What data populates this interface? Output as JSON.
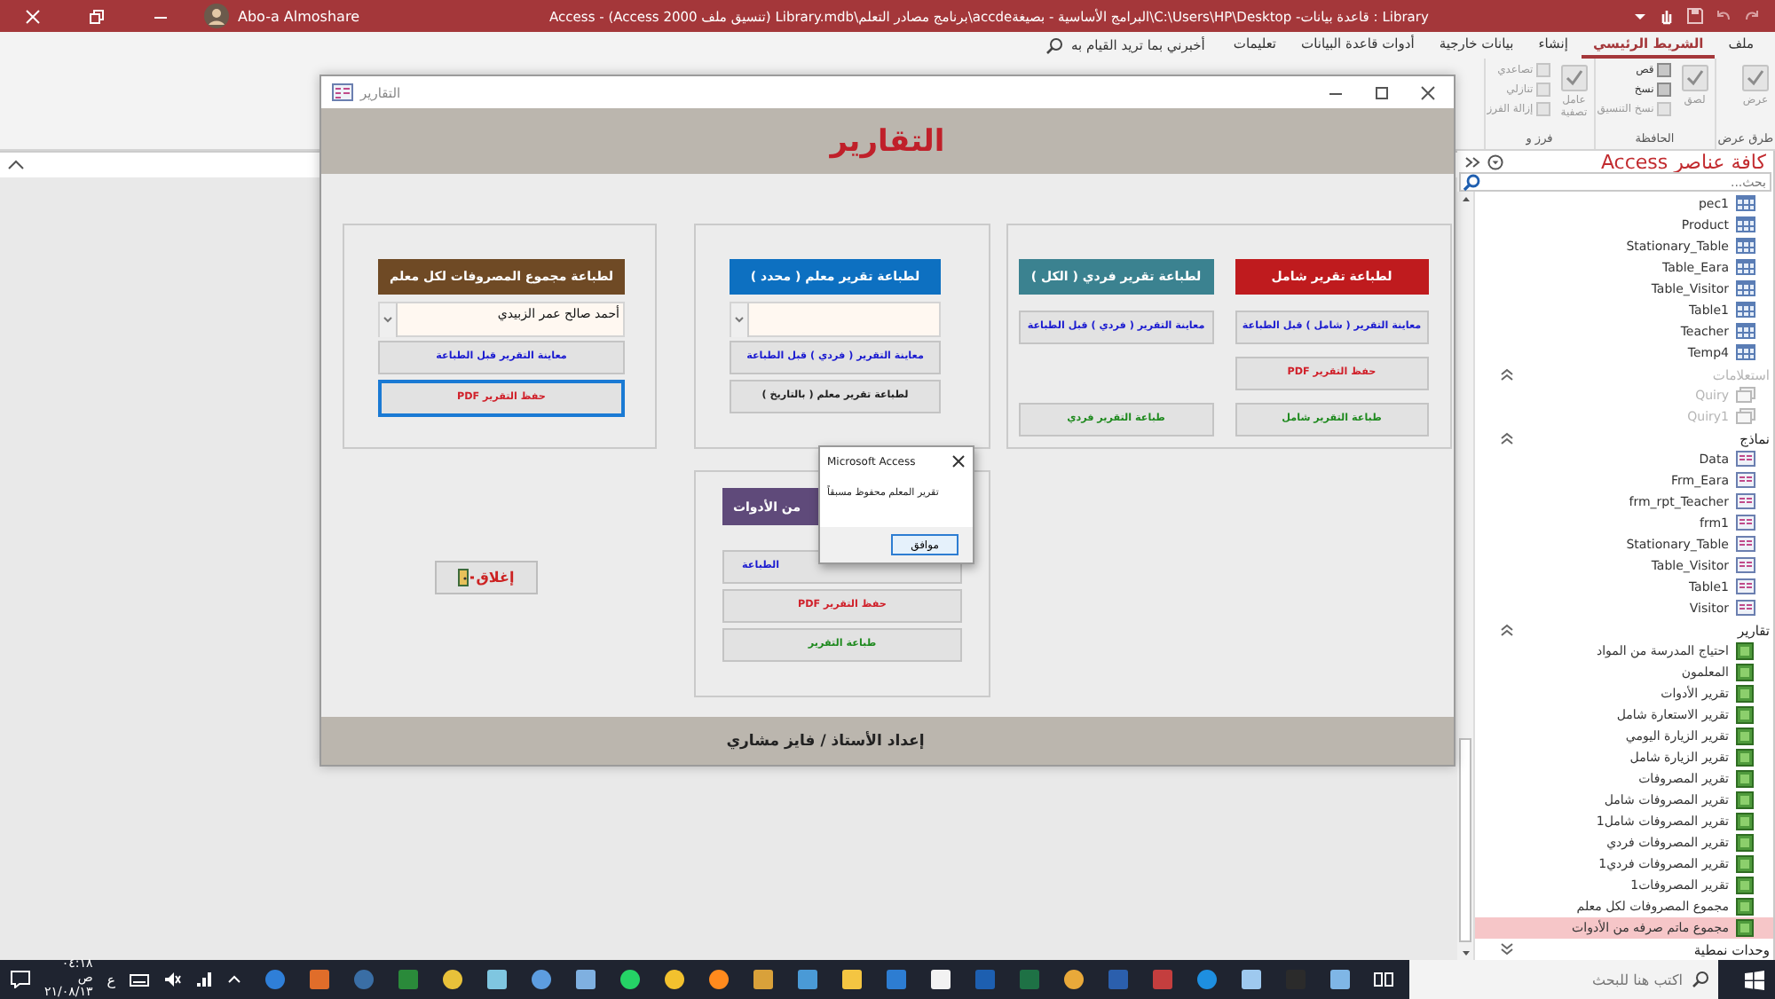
{
  "title_bar": {
    "title": "Library : قاعدة بيانات- C:\\Users\\HP\\Desktop\\البرامج الأساسية - بصيغةaccde\\برنامج مصادر التعلم\\Library.mdb (تنسيق ملف Access 2000) - Access",
    "user": "Abo-a Almoshare"
  },
  "ribbon": {
    "tabs": [
      {
        "label": "ملف",
        "selected": false
      },
      {
        "label": "الشريط الرئيسي",
        "selected": true
      },
      {
        "label": "إنشاء",
        "selected": false
      },
      {
        "label": "بيانات خارجية",
        "selected": false
      },
      {
        "label": "أدوات قاعدة البيانات",
        "selected": false
      },
      {
        "label": "تعليمات",
        "selected": false
      }
    ],
    "tell_me": "أخبرني بما تريد القيام به",
    "groups": [
      {
        "label": "طرق عرض",
        "commands": [
          {
            "label": "عرض",
            "kind": "large",
            "disabled": true
          }
        ]
      },
      {
        "label": "الحافظة",
        "commands": [
          {
            "label": "لصق",
            "kind": "large",
            "disabled": true
          },
          {
            "label": "قص",
            "kind": "small",
            "disabled": false
          },
          {
            "label": "نسخ",
            "kind": "small",
            "disabled": false
          },
          {
            "label": "نسخ التنسيق",
            "kind": "small",
            "disabled": true
          }
        ]
      },
      {
        "label": "فرز و",
        "commands": [
          {
            "label": "عامل تصفية",
            "kind": "large",
            "disabled": true
          },
          {
            "label": "تصاعدي",
            "kind": "small",
            "disabled": true
          },
          {
            "label": "تنازلي",
            "kind": "small",
            "disabled": true
          },
          {
            "label": "إزالة الفرز",
            "kind": "small",
            "disabled": true
          }
        ]
      }
    ]
  },
  "form_window": {
    "title": "التقارير",
    "heading": "التقارير",
    "panels": [
      {
        "sections": [
          {
            "header": "لطباعة تقرير شامل",
            "color": "#bf1b1e",
            "buttons": [
              {
                "label": "معاينة التقرير ( شامل ) قبل الطباعة",
                "kind": "preview",
                "focused": false
              },
              {
                "label": "حفظ التقرير PDF",
                "kind": "pdf",
                "focused": false
              },
              {
                "label": "طباعة التقرير شامل",
                "kind": "print",
                "focused": false
              }
            ]
          },
          {
            "header": "لطباعة تقرير فردي ( الكل )",
            "color": "#3b8290",
            "buttons": [
              {
                "label": "معاينة التقرير ( فردي ) قبل الطباعة",
                "kind": "preview",
                "focused": false
              },
              {
                "label": "طباعة التقرير فردي",
                "kind": "print",
                "focused": false
              }
            ]
          }
        ]
      },
      {
        "sections": [
          {
            "header": "لطباعة تقرير معلم ( محدد )",
            "color": "#0d70c1",
            "combo": {
              "kind": "dropdown"
            },
            "buttons": [
              {
                "label": "معاينة التقرير ( فردي ) قبل الطباعة",
                "kind": "preview",
                "focused": false
              },
              {
                "label": "لطباعة تقرير معلم ( بالتاريخ )",
                "kind": "date",
                "focused": false
              }
            ]
          }
        ]
      },
      {
        "sections": [
          {
            "header": "لطباعة مجموع المصروفات لكل معلم",
            "color": "#6f4a25",
            "combo": {
              "kind": "dropdown",
              "value": "أحمد صالح عمر الزبيدي"
            },
            "buttons": [
              {
                "label": "معاينة التقرير قبل الطباعة",
                "kind": "preview",
                "focused": false
              },
              {
                "label": "حفظ التقرير PDF",
                "kind": "pdf",
                "focused": true
              }
            ]
          }
        ]
      },
      {
        "sections": [
          {
            "header": "من الأدوات",
            "color": "#5f4a7a",
            "buttons": [
              {
                "label": "الطباعة",
                "kind": "preview",
                "focused": false
              },
              {
                "label": "حفظ التقرير PDF",
                "kind": "pdf",
                "focused": false
              },
              {
                "label": "طباعة التقرير",
                "kind": "print",
                "focused": false
              }
            ]
          }
        ]
      }
    ],
    "close_button": "إغلاق",
    "footer": "إعداد الأستاذ / فايز مشاري"
  },
  "dialog": {
    "title": "Microsoft Access",
    "message": "تقرير المعلم محفوظ مسبقاً",
    "button": "موافق"
  },
  "nav_pane": {
    "title": "كافة عناصر Access",
    "search": {
      "placeholder": "بحث..."
    },
    "groups": [
      {
        "kind": "table",
        "disabled": false,
        "items": [
          {
            "label": "pec1",
            "selected": false
          },
          {
            "label": "Product",
            "selected": false
          },
          {
            "label": "Stationary_Table",
            "selected": false
          },
          {
            "label": "Table_Eara",
            "selected": false
          },
          {
            "label": "Table_Visitor",
            "selected": false
          },
          {
            "label": "Table1",
            "selected": false
          },
          {
            "label": "Teacher",
            "selected": false
          },
          {
            "label": "Temp4",
            "selected": false
          }
        ]
      },
      {
        "kind": "query",
        "label": "استعلامات",
        "expanded": true,
        "disabled": true,
        "items": [
          {
            "label": "Quiry",
            "selected": false
          },
          {
            "label": "Quiry1",
            "selected": false
          }
        ]
      },
      {
        "kind": "form",
        "label": "نماذج",
        "expanded": true,
        "disabled": false,
        "items": [
          {
            "label": "Data",
            "selected": false
          },
          {
            "label": "Frm_Eara",
            "selected": false
          },
          {
            "label": "frm_rpt_Teacher",
            "selected": false
          },
          {
            "label": "frm1",
            "selected": false
          },
          {
            "label": "Stationary_Table",
            "selected": false
          },
          {
            "label": "Table_Visitor",
            "selected": false
          },
          {
            "label": "Table1",
            "selected": false
          },
          {
            "label": "Visitor",
            "selected": false
          }
        ]
      },
      {
        "kind": "report",
        "label": "تقارير",
        "expanded": true,
        "disabled": false,
        "items": [
          {
            "label": "احتياج المدرسة من المواد",
            "selected": false
          },
          {
            "label": "المعلمون",
            "selected": false
          },
          {
            "label": "تقرير الأدوات",
            "selected": false
          },
          {
            "label": "تقرير الاستعارة شامل",
            "selected": false
          },
          {
            "label": "تقرير الزيارة اليومي",
            "selected": false
          },
          {
            "label": "تقرير الزيارة شامل",
            "selected": false
          },
          {
            "label": "تقرير المصروفات",
            "selected": false
          },
          {
            "label": "تقرير المصروفات شامل",
            "selected": false
          },
          {
            "label": "تقرير المصروفات شامل1",
            "selected": false
          },
          {
            "label": "تقرير المصروفات فردي",
            "selected": false
          },
          {
            "label": "تقرير المصروفات فردي1",
            "selected": false
          },
          {
            "label": "تقرير المصروفات1",
            "selected": false
          },
          {
            "label": "مجموع المصروفات لكل معلم",
            "selected": false
          },
          {
            "label": "مجموع ماتم صرفه من الأدوات",
            "selected": true
          }
        ]
      },
      {
        "label": "وحدات نمطية",
        "expanded": false
      }
    ]
  },
  "taskbar": {
    "search": {
      "placeholder": "اكتب هنا للبحث"
    },
    "language": "ع",
    "time": "٠٤:١٨ ص",
    "date": "٢١/٠٨/١٣"
  }
}
